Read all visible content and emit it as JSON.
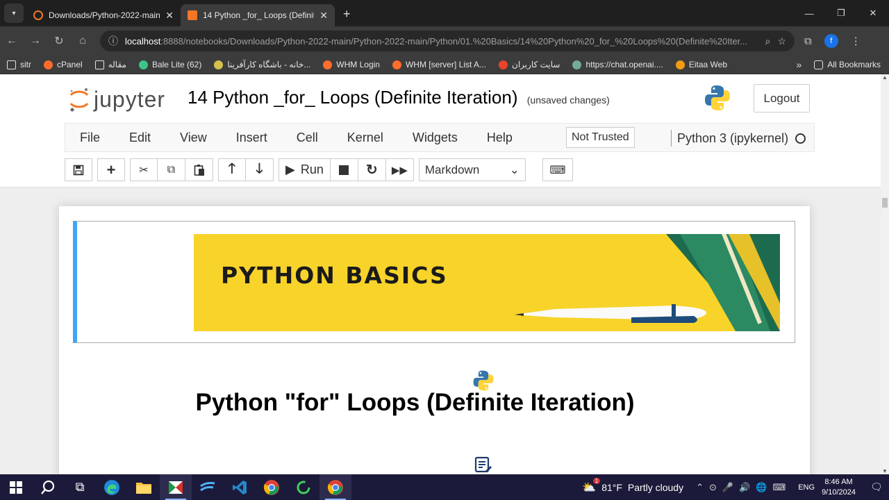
{
  "browser": {
    "tabs": [
      {
        "title": "Downloads/Python-2022-main/",
        "active": false
      },
      {
        "title": "14 Python _for_ Loops (Definite",
        "active": true
      }
    ],
    "url_host": "localhost",
    "url_rest": ":8888/notebooks/Downloads/Python-2022-main/Python-2022-main/Python/01.%20Basics/14%20Python%20_for_%20Loops%20(Definite%20Iter...",
    "profile_initial": "f",
    "bookmarks": [
      {
        "label": "sitr",
        "icon": "folder-icon",
        "color": "#e6e6e6"
      },
      {
        "label": "cPanel",
        "icon": "cpanel-icon",
        "color": "#ff6c2c"
      },
      {
        "label": "مقاله",
        "icon": "folder-icon",
        "color": "#e6e6e6"
      },
      {
        "label": "Bale Lite (62)",
        "icon": "bale-icon",
        "color": "#3cc48a"
      },
      {
        "label": "خانه - باشگاه کارآفرینا...",
        "icon": "club-icon",
        "color": "#d4c14a"
      },
      {
        "label": "WHM Login",
        "icon": "cpanel-icon",
        "color": "#ff6c2c"
      },
      {
        "label": "WHM [server] List A...",
        "icon": "cpanel-icon",
        "color": "#ff6c2c"
      },
      {
        "label": "سایت کاربران",
        "icon": "fruit-icon",
        "color": "#e8442b"
      },
      {
        "label": "https://chat.openai....",
        "icon": "openai-icon",
        "color": "#74aa9c"
      },
      {
        "label": "Eitaa Web",
        "icon": "eitaa-icon",
        "color": "#f39c12"
      }
    ],
    "all_bookmarks": "All Bookmarks"
  },
  "jupyter": {
    "logo_text": "jupyter",
    "notebook_title": "14 Python _for_ Loops (Definite Iteration)",
    "save_status": "(unsaved changes)",
    "logout": "Logout",
    "menu": [
      "File",
      "Edit",
      "View",
      "Insert",
      "Cell",
      "Kernel",
      "Widgets",
      "Help"
    ],
    "trust": "Not Trusted",
    "kernel": "Python 3 (ipykernel)",
    "run_label": "Run",
    "cell_type": "Markdown"
  },
  "notebook": {
    "banner_text": "PYTHON BASICS",
    "heading": "Python \"for\" Loops (Definite Iteration)"
  },
  "taskbar": {
    "weather_temp": "81°F",
    "weather_desc": "Partly cloudy",
    "weather_badge": "1",
    "lang": "ENG",
    "time": "8:46 AM",
    "date": "9/10/2024"
  }
}
